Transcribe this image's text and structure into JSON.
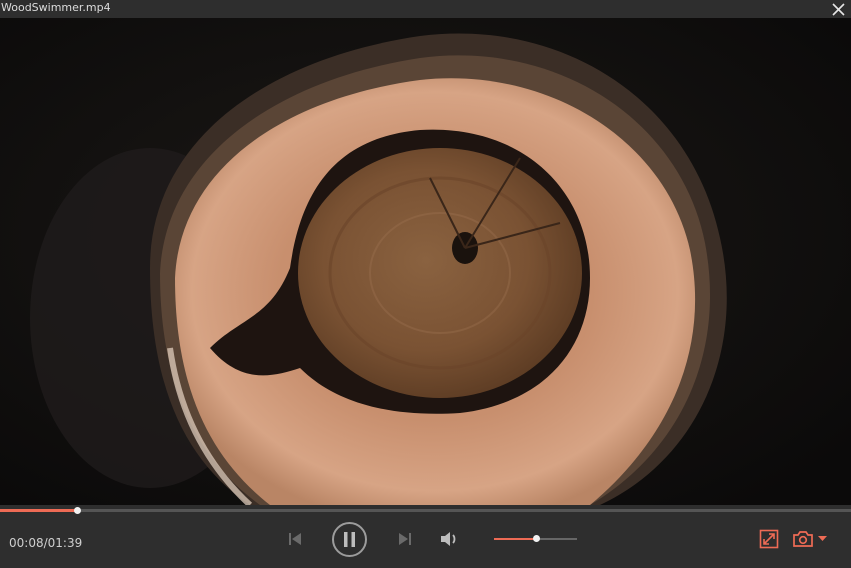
{
  "window": {
    "title": "WoodSwimmer.mp4",
    "close_icon": "close-icon"
  },
  "player": {
    "progress": 0.09,
    "time_display": "00:08/01:39",
    "volume": 0.5,
    "accent_color": "#ee6b55",
    "icons": {
      "previous": "skip-previous-icon",
      "play_pause": "pause-icon",
      "next": "skip-next-icon",
      "volume": "volume-icon",
      "fullscreen": "fullscreen-icon",
      "snapshot": "camera-icon",
      "snapshot_menu": "chevron-down-icon"
    }
  }
}
